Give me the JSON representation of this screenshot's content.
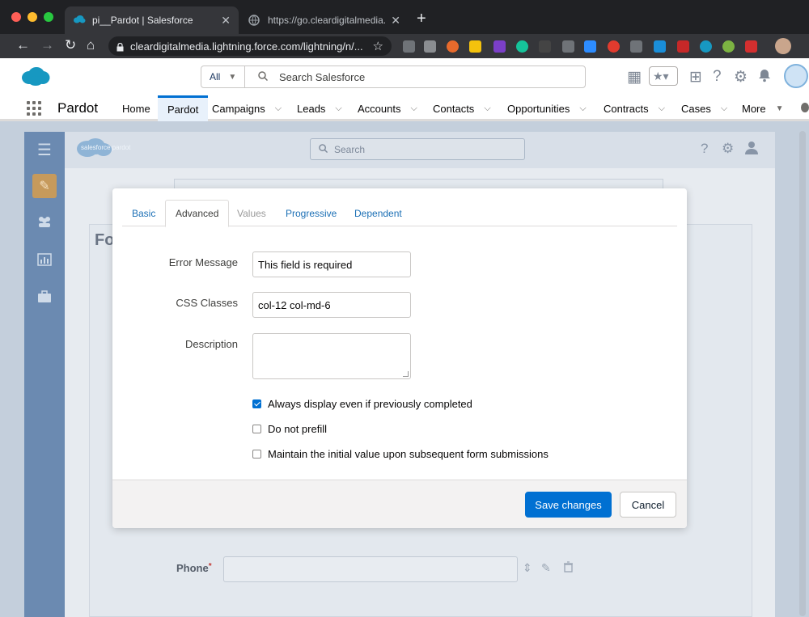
{
  "browser": {
    "active_tab_title": "pi__Pardot | Salesforce",
    "inactive_tab_title": "https://go.cleardigitalmedia.net/l",
    "new_tab_glyph": "+",
    "url": "cleardigitalmedia.lightning.force.com/lightning/n/...",
    "traffic_colors": [
      "#ff5f57",
      "#febc2e",
      "#28c840"
    ]
  },
  "sf_header": {
    "scope_label": "All",
    "search_placeholder": "Search Salesforce"
  },
  "sf_nav": {
    "app_name": "Pardot",
    "items": [
      {
        "label": "Home",
        "dropdown": false
      },
      {
        "label": "Pardot",
        "dropdown": false,
        "active": true
      },
      {
        "label": "Campaigns",
        "dropdown": true
      },
      {
        "label": "Leads",
        "dropdown": true
      },
      {
        "label": "Accounts",
        "dropdown": true
      },
      {
        "label": "Contacts",
        "dropdown": true
      },
      {
        "label": "Opportunities",
        "dropdown": true
      },
      {
        "label": "Contracts",
        "dropdown": true
      },
      {
        "label": "Cases",
        "dropdown": true
      },
      {
        "label": "More",
        "dropdown": true
      }
    ]
  },
  "pardot": {
    "logo_text": "salesforce pardot",
    "search_placeholder": "Search",
    "card_title": "Fo",
    "phone_label": "Phone",
    "required_mark": "*"
  },
  "modal": {
    "tabs": [
      {
        "label": "Basic",
        "state": "link"
      },
      {
        "label": "Advanced",
        "state": "active"
      },
      {
        "label": "Values",
        "state": "disabled"
      },
      {
        "label": "Progressive",
        "state": "link"
      },
      {
        "label": "Dependent",
        "state": "link"
      }
    ],
    "fields": {
      "error_message": {
        "label": "Error Message",
        "value": "This field is required"
      },
      "css_classes": {
        "label": "CSS Classes",
        "value": "col-12 col-md-6"
      },
      "description": {
        "label": "Description",
        "value": ""
      }
    },
    "checkboxes": [
      {
        "label": "Always display even if previously completed",
        "checked": true
      },
      {
        "label": "Do not prefill",
        "checked": false
      },
      {
        "label": "Maintain the initial value upon subsequent form submissions",
        "checked": false
      }
    ],
    "save_label": "Save changes",
    "cancel_label": "Cancel"
  },
  "colors": {
    "brand_blue": "#0070d2",
    "chrome_dark": "#202124",
    "overlay": "#c4cfdc",
    "pardot_rail": "#6b8ab1"
  }
}
